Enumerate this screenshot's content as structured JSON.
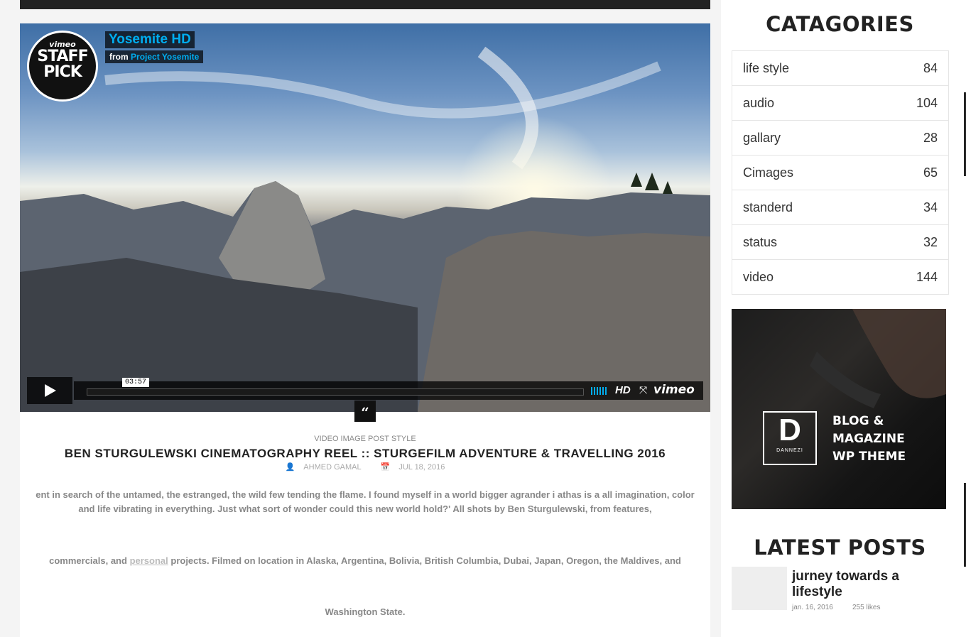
{
  "video": {
    "badge_top": "vimeo",
    "badge_line1": "STAFF",
    "badge_line2": "PICK",
    "title": "Yosemite HD",
    "from_prefix": "from",
    "from_channel": "Project Yosemite",
    "time": "03:57",
    "hd_label": "HD",
    "vimeo_label": "vimeo"
  },
  "post": {
    "category": "VIDEO IMAGE POST STYLE",
    "title": "BEN STURGULEWSKI CINEMATOGRAPHY REEL :: STURGEFILM ADVENTURE & TRAVELLING 2016",
    "author": "AHMED GAMAL",
    "date": "JUL 18, 2016",
    "para1": "ent in search of the untamed, the estranged, the wild few tending the flame. I found myself in a world bigger agrander i athas is a all imagination, color and life vibrating in everything. Just what sort of wonder could this new world hold?' All shots by Ben Sturgulewski, from features,",
    "para2_pre": "commercials, and",
    "para2_link": "personal",
    "para2_post": "projects. Filmed on location in Alaska, Argentina, Bolivia, British Columbia, Dubai, Japan, Oregon, the Maldives, and",
    "para3": "Washington State."
  },
  "sidebar": {
    "categories_title": "CATAGORIES",
    "categories": [
      {
        "name": "life style",
        "count": "84"
      },
      {
        "name": "audio",
        "count": "104"
      },
      {
        "name": "gallary",
        "count": "28"
      },
      {
        "name": "Cimages",
        "count": "65"
      },
      {
        "name": "standerd",
        "count": "34"
      },
      {
        "name": "status",
        "count": "32"
      },
      {
        "name": "video",
        "count": "144"
      }
    ],
    "ad": {
      "logo_letter": "D",
      "logo_small": "DANNEZI",
      "line1": "BLOG &",
      "line2": "MAGAZINE",
      "line3": "WP THEME"
    },
    "latest_title": "LATEST POSTS",
    "latest": [
      {
        "title": "jurney towards a lifestyle",
        "date": "jan. 16, 2016",
        "likes": "255 likes"
      }
    ]
  }
}
